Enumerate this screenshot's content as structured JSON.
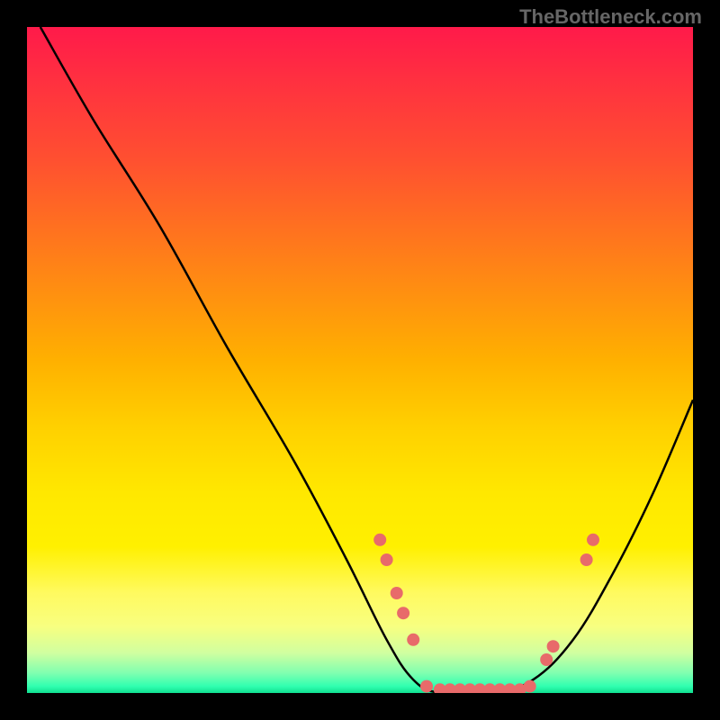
{
  "watermark": "TheBottleneck.com",
  "chart_data": {
    "type": "line",
    "title": "",
    "xlabel": "",
    "ylabel": "",
    "xlim": [
      0,
      100
    ],
    "ylim": [
      0,
      100
    ],
    "curve": [
      {
        "x": 2,
        "y": 100
      },
      {
        "x": 10,
        "y": 86
      },
      {
        "x": 20,
        "y": 70
      },
      {
        "x": 30,
        "y": 52
      },
      {
        "x": 40,
        "y": 35
      },
      {
        "x": 48,
        "y": 20
      },
      {
        "x": 54,
        "y": 8
      },
      {
        "x": 58,
        "y": 2
      },
      {
        "x": 62,
        "y": 0
      },
      {
        "x": 70,
        "y": 0
      },
      {
        "x": 76,
        "y": 2
      },
      {
        "x": 82,
        "y": 8
      },
      {
        "x": 88,
        "y": 18
      },
      {
        "x": 94,
        "y": 30
      },
      {
        "x": 100,
        "y": 44
      }
    ],
    "points": [
      {
        "x": 53,
        "y": 23
      },
      {
        "x": 54,
        "y": 20
      },
      {
        "x": 55.5,
        "y": 15
      },
      {
        "x": 56.5,
        "y": 12
      },
      {
        "x": 58,
        "y": 8
      },
      {
        "x": 60,
        "y": 1
      },
      {
        "x": 62,
        "y": 0.5
      },
      {
        "x": 63.5,
        "y": 0.5
      },
      {
        "x": 65,
        "y": 0.5
      },
      {
        "x": 66.5,
        "y": 0.5
      },
      {
        "x": 68,
        "y": 0.5
      },
      {
        "x": 69.5,
        "y": 0.5
      },
      {
        "x": 71,
        "y": 0.5
      },
      {
        "x": 72.5,
        "y": 0.5
      },
      {
        "x": 74,
        "y": 0.5
      },
      {
        "x": 75.5,
        "y": 1
      },
      {
        "x": 78,
        "y": 5
      },
      {
        "x": 79,
        "y": 7
      },
      {
        "x": 84,
        "y": 20
      },
      {
        "x": 85,
        "y": 23
      }
    ],
    "background": "vertical-gradient-red-to-green"
  }
}
